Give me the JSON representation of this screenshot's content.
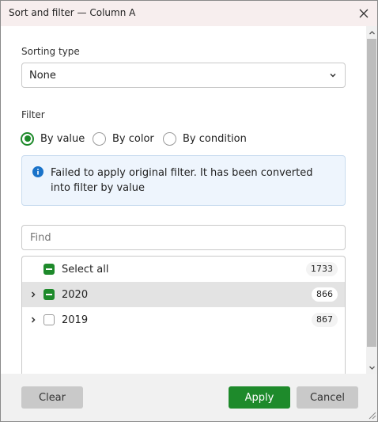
{
  "window": {
    "title": "Sort and filter — Column A"
  },
  "sorting": {
    "label": "Sorting type",
    "selected": "None"
  },
  "filter": {
    "label": "Filter",
    "options": [
      "By value",
      "By color",
      "By condition"
    ],
    "selected": "By value"
  },
  "info": {
    "message": "Failed to apply original filter. It has been converted into filter by value"
  },
  "search": {
    "placeholder": "Find",
    "value": ""
  },
  "list": {
    "items": [
      {
        "label": "Select all",
        "count": "1733",
        "checkbox": "partial",
        "expandable": false,
        "selected": false
      },
      {
        "label": "2020",
        "count": "866",
        "checkbox": "partial",
        "expandable": true,
        "selected": true
      },
      {
        "label": "2019",
        "count": "867",
        "checkbox": "unchecked",
        "expandable": true,
        "selected": false
      }
    ]
  },
  "buttons": {
    "clear": "Clear",
    "apply": "Apply",
    "cancel": "Cancel"
  },
  "colors": {
    "accent": "#1e8a2b",
    "info_bg": "#eef5fd",
    "info_icon": "#1a73c9",
    "title_bg": "#f7eeee"
  },
  "icons": {
    "close": "close-icon",
    "dropdown": "chevron-down-icon",
    "info": "info-icon",
    "expand": "chevron-right-icon"
  }
}
